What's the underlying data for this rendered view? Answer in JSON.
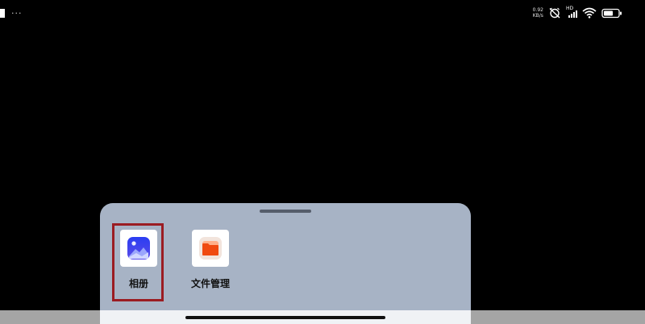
{
  "status_bar": {
    "left_dots": "···",
    "network_speed_value": "0.92",
    "network_speed_unit": "KB/s",
    "signal_label": "HD"
  },
  "app_sheet": {
    "apps": [
      {
        "label": "相册",
        "icon": "gallery-icon"
      },
      {
        "label": "文件管理",
        "icon": "folder-icon"
      }
    ],
    "highlighted_app": "相册"
  },
  "colors": {
    "background": "#000000",
    "sheet": "#a7b3c5",
    "highlight_border": "#9b1c22",
    "gallery_blue": "#3b46f0",
    "folder_orange": "#f04a10"
  }
}
